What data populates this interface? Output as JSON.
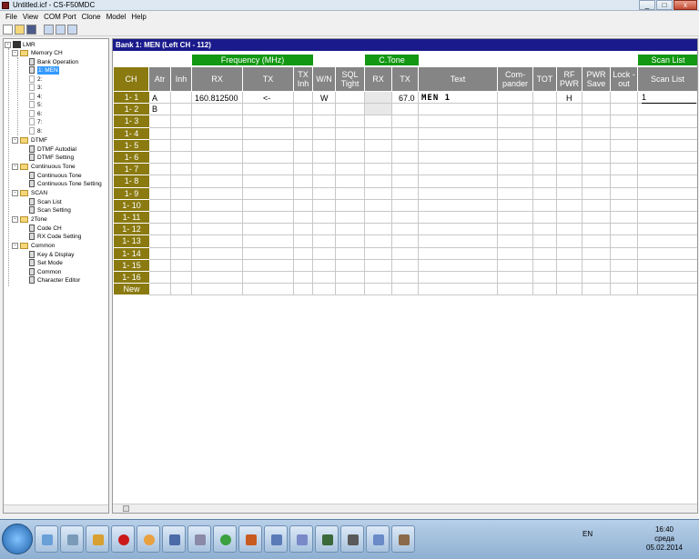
{
  "window": {
    "title": "Untitled.icf - CS-F50MDC",
    "buttons": [
      "_",
      "□",
      "x"
    ]
  },
  "menubar": {
    "items": [
      "File",
      "View",
      "COM Port",
      "Clone",
      "Model",
      "Help"
    ]
  },
  "toolbar": {
    "buttons": [
      "new-icon",
      "open-icon",
      "save-icon",
      "read-icon",
      "write-icon",
      "clone-icon"
    ]
  },
  "tree": {
    "root": "LMR",
    "memory_ch": "Memory CH",
    "bank_operation": "Bank Operation",
    "banks": [
      "1: MEN",
      "2:",
      "3:",
      "4:",
      "5:",
      "6:",
      "7:",
      "8:"
    ],
    "dtmf": "DTMF",
    "dtmf_autodial": "DTMF Autodial",
    "dtmf_setting": "DTMF Setting",
    "continuous_tone": "Continuous Tone",
    "continuous_tone_item": "Continuous Tone",
    "continuous_tone_setting": "Continuous Tone Setting",
    "scan": "SCAN",
    "scan_list": "Scan List",
    "scan_setting": "Scan Setting",
    "two_tone": "2Tone",
    "code_ch": "Code CH",
    "rx_code_setting": "RX Code Setting",
    "common": "Common",
    "key_display": "Key & Display",
    "set_mode": "Set Mode",
    "common_item": "Common",
    "character_editor": "Character Editor"
  },
  "bank_header": "Bank 1: MEN     (Left CH - 112)",
  "groups": {
    "frequency": "Frequency (MHz)",
    "ctone": "C.Tone",
    "scan_list": "Scan List"
  },
  "columns": {
    "ch": "CH",
    "atr": "Atr",
    "inh": "Inh",
    "rx": "RX",
    "tx": "TX",
    "tx_inh": "TX Inh",
    "wn": "W/N",
    "sql_tight": "SQL Tight",
    "ctone_rx": "RX",
    "ctone_tx": "TX",
    "text": "Text",
    "compander": "Com- pander",
    "tot": "TOT",
    "rf_pwr": "RF PWR",
    "pwr_save": "PWR Save",
    "lockout": "Lock -out",
    "scan_list": "Scan List"
  },
  "channels": [
    "1- 1",
    "1- 2",
    "1- 3",
    "1- 4",
    "1- 5",
    "1- 6",
    "1- 7",
    "1- 8",
    "1- 9",
    "1- 10",
    "1- 11",
    "1- 12",
    "1- 13",
    "1- 14",
    "1- 15",
    "1- 16",
    "New"
  ],
  "row1": {
    "atr": "A",
    "rx": "160.812500",
    "tx": "<-",
    "wn": "W",
    "ctone_tx": "67.0",
    "text": "MEN 1",
    "rf_pwr": "H",
    "scan_list": "1"
  },
  "row2": {
    "atr": "B"
  },
  "taskbar": {
    "lang": "EN",
    "time": "16:40",
    "day": "среда",
    "date": "05.02.2014"
  },
  "colors": {
    "green_header": "#129812",
    "ch_header": "#8a7a10",
    "bank_bar": "#1a1a8c",
    "grey_header": "#858585"
  }
}
